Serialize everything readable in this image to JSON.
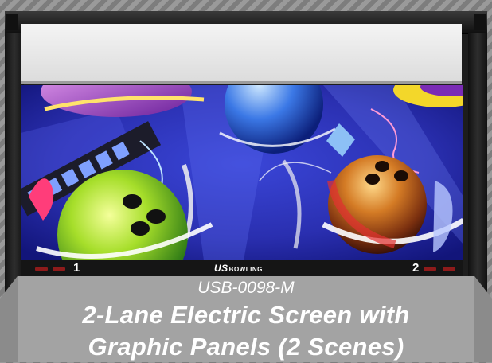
{
  "product": {
    "model": "USB-0098-M",
    "title_line1": "2-Lane Electric Screen with",
    "title_line2": "Graphic Panels (2 Scenes)"
  },
  "lanes": {
    "left": "1",
    "right": "2"
  },
  "brand": {
    "mark": "US",
    "name": "BOWLING"
  },
  "colors": {
    "frame": "#1d1d1d",
    "panel_bg": "#2a2fb0",
    "label_plate": "#a3a3a3",
    "lane_light": "#8e1b1b"
  }
}
